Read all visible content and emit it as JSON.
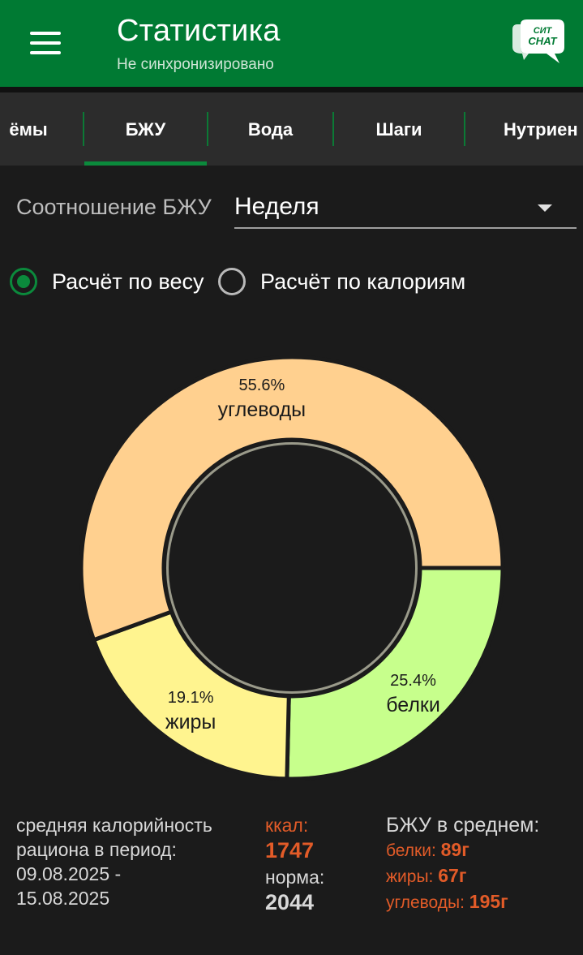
{
  "header": {
    "title": "Статистика",
    "subtitle": "Не синхронизировано",
    "logo_text_1": "СИТ",
    "logo_text_2": "CHAT"
  },
  "tabs": [
    {
      "label": "ёмы"
    },
    {
      "label": "БЖУ",
      "active": true
    },
    {
      "label": "Вода"
    },
    {
      "label": "Шаги"
    },
    {
      "label": "Нутриен"
    }
  ],
  "filter": {
    "label": "Соотношение БЖУ",
    "period": "Неделя"
  },
  "calc_mode": {
    "by_weight": "Расчёт по весу",
    "by_calories": "Расчёт по калориям",
    "selected": "by_weight"
  },
  "chart_data": {
    "type": "pie",
    "categories": [
      "белки",
      "жиры",
      "углеводы"
    ],
    "values": [
      25.4,
      19.1,
      55.6
    ],
    "labels": [
      "25.4%",
      "19.1%",
      "55.6%"
    ],
    "colors": [
      "#c7ff8c",
      "#fff48f",
      "#ffd08f"
    ]
  },
  "summary": {
    "avg_line1": "средняя калорийность",
    "avg_line2": "рациона в период:",
    "date_from": "09.08.2025 -",
    "date_to": "15.08.2025",
    "kcal_label": "ккал:",
    "kcal_value": "1747",
    "norm_label": "норма:",
    "norm_value": "2044",
    "avg_title": "БЖУ в среднем:",
    "protein_label": "белки:",
    "protein_value": "89г",
    "fat_label": "жиры:",
    "fat_value": "67г",
    "carb_label": "углеводы:",
    "carb_value": "195г"
  }
}
